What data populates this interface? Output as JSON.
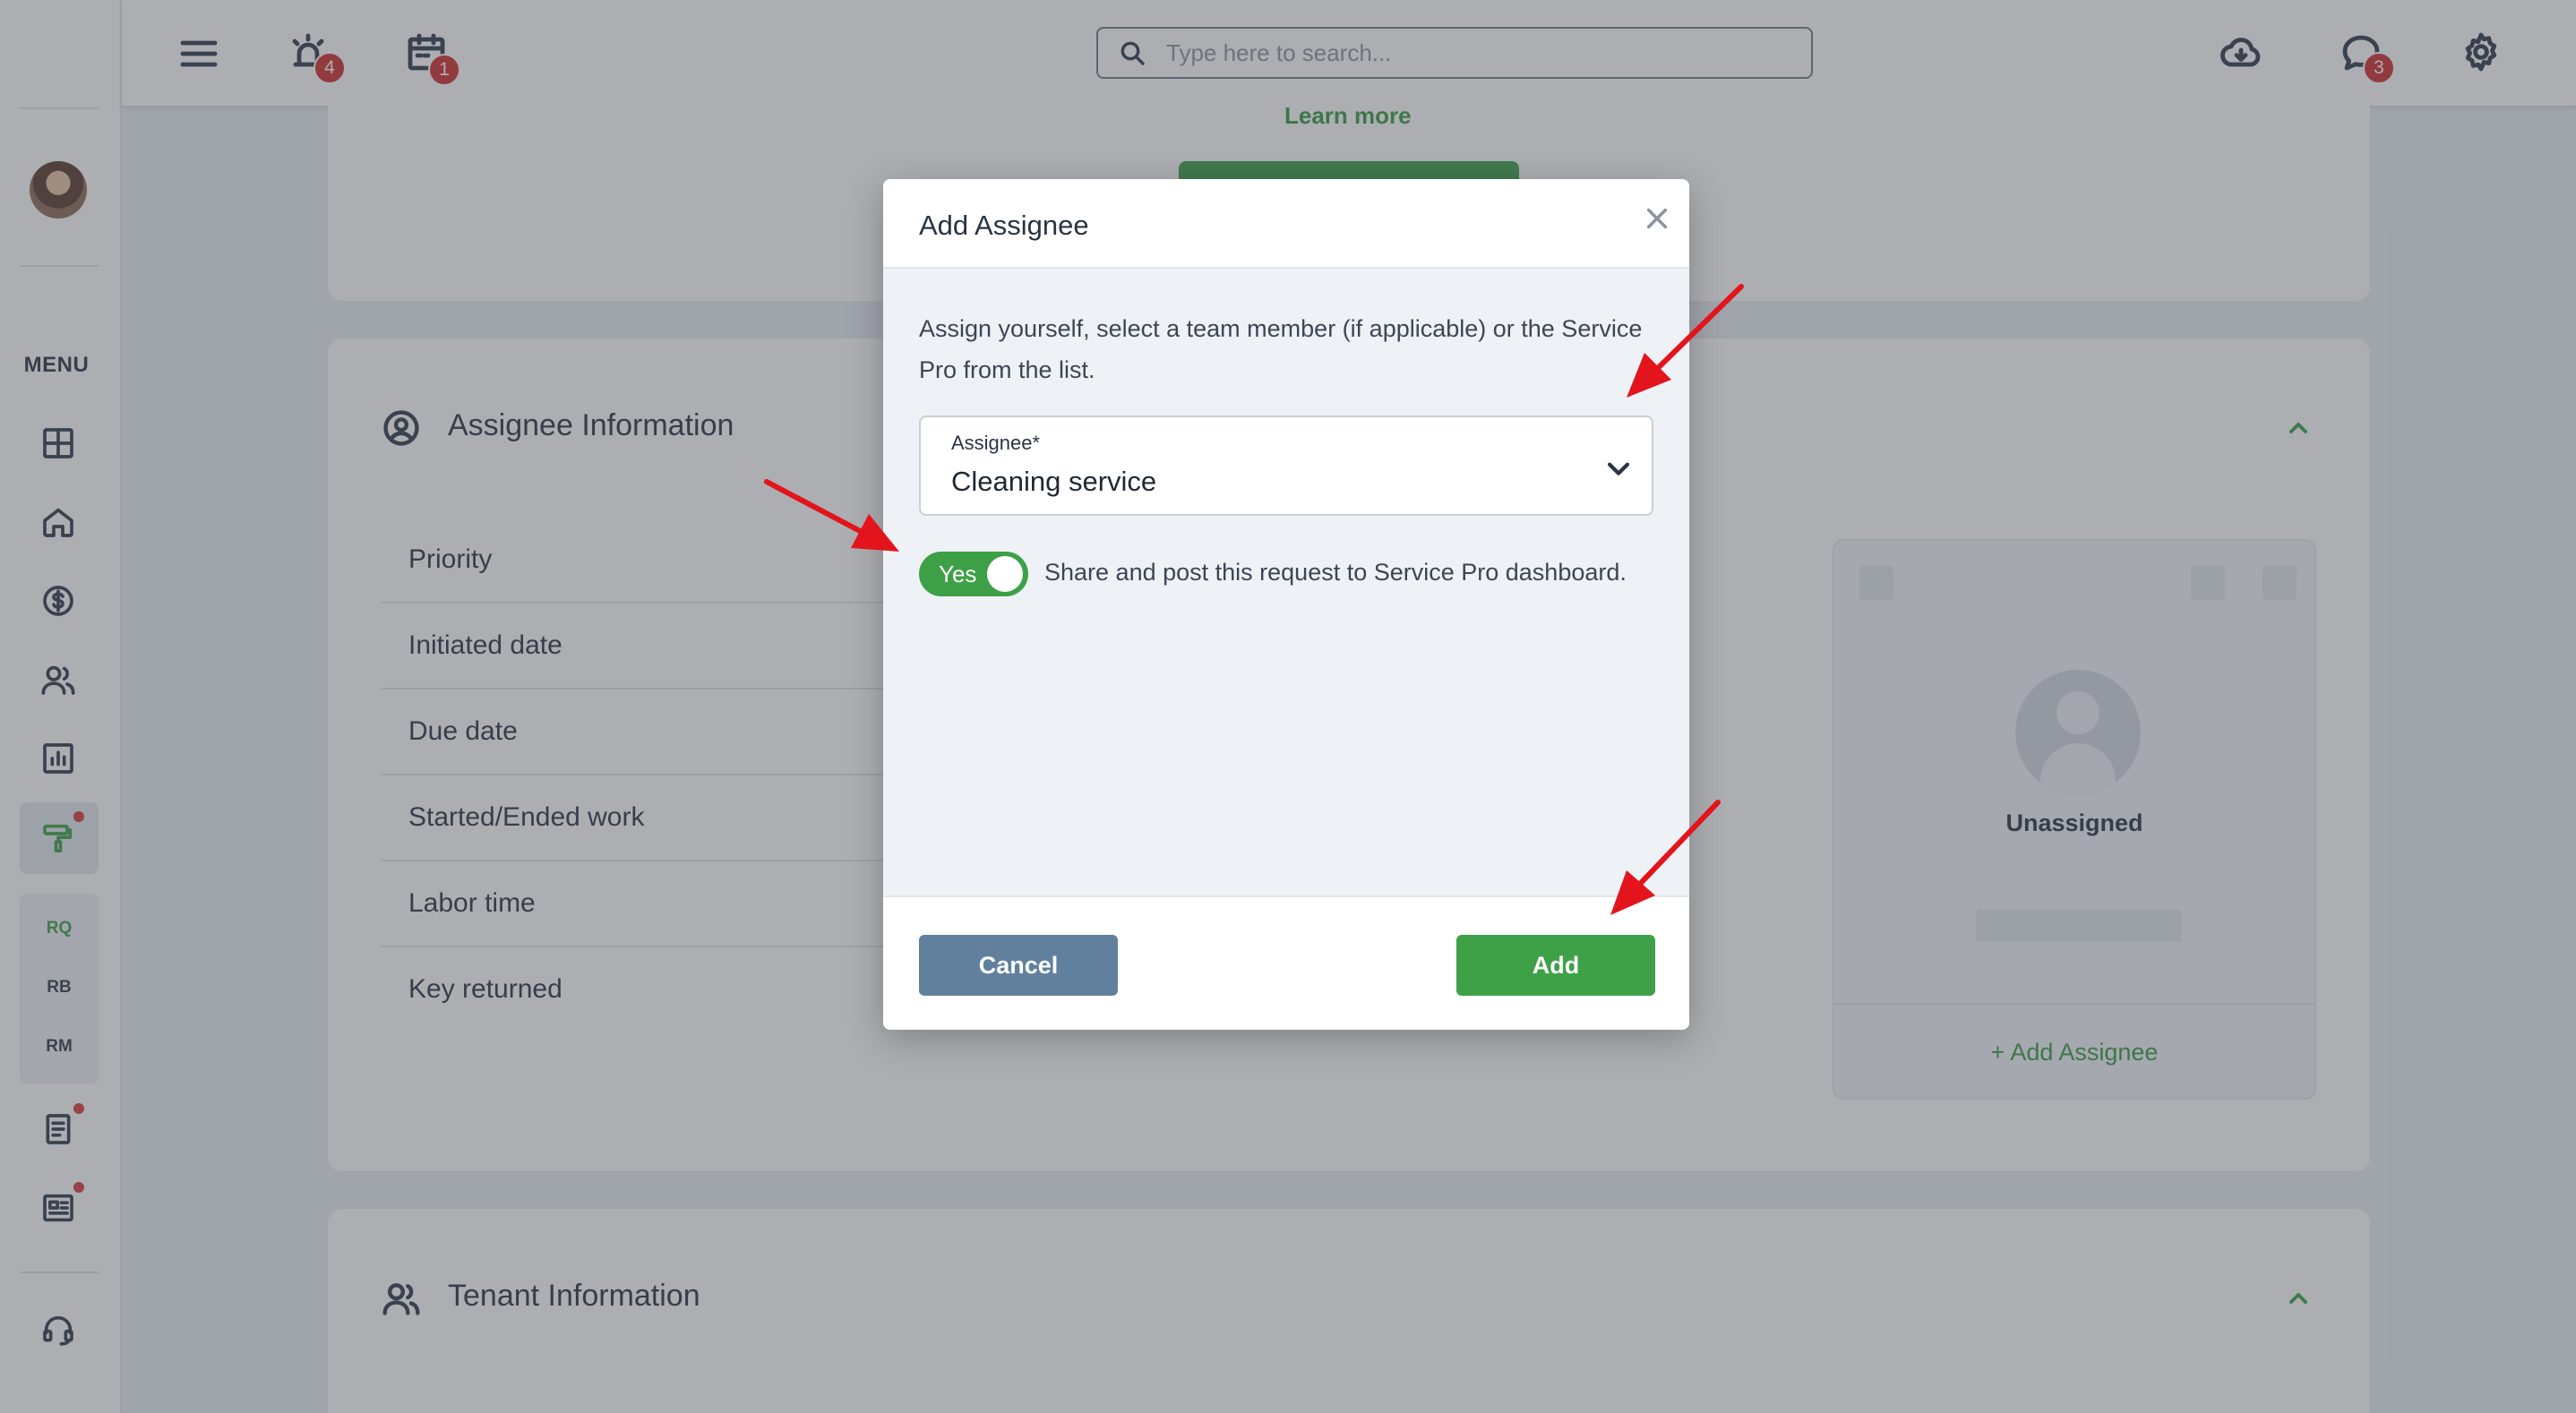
{
  "topbar": {
    "menu_icon": "hamburger-icon",
    "alarm_badge": "4",
    "calendar_badge": "1",
    "chat_badge": "3",
    "search_placeholder": "Type here to search..."
  },
  "sidebar": {
    "menu_label": "MENU",
    "sub_items": [
      "RQ",
      "RB",
      "RM"
    ]
  },
  "background": {
    "learn_more": "Learn more",
    "assignee_section_title": "Assignee Information",
    "fields": [
      "Priority",
      "Initiated date",
      "Due date",
      "Started/Ended work",
      "Labor time",
      "Key returned"
    ],
    "unassigned_label": "Unassigned",
    "add_assignee_link": "+ Add Assignee",
    "tenant_section_title": "Tenant Information"
  },
  "modal": {
    "title": "Add Assignee",
    "description": "Assign yourself, select a team member (if applicable) or the Service Pro from the list.",
    "select_label": "Assignee*",
    "select_value": "Cleaning service",
    "toggle_text": "Yes",
    "toggle_on": true,
    "toggle_label": "Share and post this request to Service Pro dashboard.",
    "cancel_label": "Cancel",
    "add_label": "Add"
  },
  "colors": {
    "accent_green": "#3da047",
    "cancel_blue": "#60809e",
    "badge_red": "#cf2f2f",
    "annotation_arrow": "#e3141b"
  }
}
